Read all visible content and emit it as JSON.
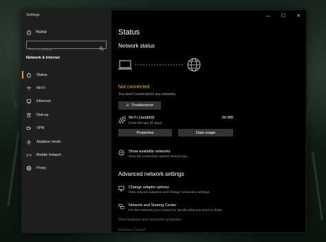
{
  "window": {
    "app_title": "Settings",
    "minimize": "—",
    "maximize": "☐",
    "close": "✕"
  },
  "sidebar": {
    "home": "Home",
    "search_placeholder": "Find a setting",
    "section": "Network & Internet",
    "items": [
      {
        "label": "Status",
        "icon": "home-status-icon",
        "active": true
      },
      {
        "label": "Wi-Fi",
        "icon": "wifi-icon",
        "active": false
      },
      {
        "label": "Ethernet",
        "icon": "ethernet-icon",
        "active": false
      },
      {
        "label": "Dial-up",
        "icon": "dialup-icon",
        "active": false
      },
      {
        "label": "VPN",
        "icon": "vpn-icon",
        "active": false
      },
      {
        "label": "Airplane mode",
        "icon": "airplane-icon",
        "active": false
      },
      {
        "label": "Mobile hotspot",
        "icon": "hotspot-icon",
        "active": false
      },
      {
        "label": "Proxy",
        "icon": "globe-icon",
        "active": false
      }
    ]
  },
  "main": {
    "title": "Status",
    "network_status_heading": "Network status",
    "status_title": "Not connected",
    "status_sub": "You aren't connected to any networks.",
    "troubleshoot": "Troubleshoot",
    "wifi": {
      "name": "Wi-Fi (Jurplt69)",
      "sub": "From the last 30 days",
      "usage": "56 MB"
    },
    "properties": "Properties",
    "data_usage": "Data usage",
    "show_networks": {
      "title": "Show available networks",
      "desc": "View the connection options around you."
    },
    "advanced_heading": "Advanced network settings",
    "adapter": {
      "title": "Change adapter options",
      "desc": "View network adapters and change connection settings."
    },
    "sharing": {
      "title": "Network and Sharing Center",
      "desc": "For the networks you connect to, decide what you want to share."
    },
    "hw_props": "View hardware and connection properties",
    "firewall": "Windows Firewall"
  },
  "colors": {
    "accent": "#f0a030",
    "warning": "#f0b429",
    "sidebar": "#1f1f1f",
    "button": "#333333"
  }
}
